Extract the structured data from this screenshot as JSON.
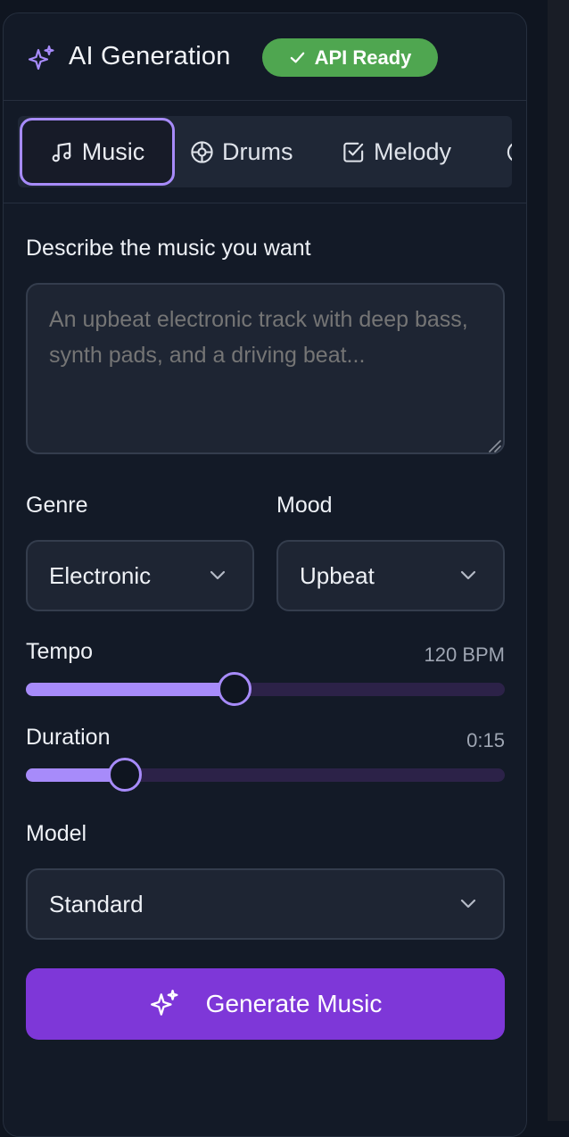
{
  "header": {
    "title": "AI Generation",
    "badge": "API Ready",
    "badge_color": "#4fa650",
    "icon": "sparkle-icon"
  },
  "tabs": [
    {
      "label": "Music",
      "icon": "music-note-icon",
      "active": true
    },
    {
      "label": "Drums",
      "icon": "drum-icon",
      "active": false
    },
    {
      "label": "Melody",
      "icon": "checkbox-icon",
      "active": false
    }
  ],
  "prompt": {
    "label": "Describe the music you want",
    "placeholder": "An upbeat electronic track with deep bass, synth pads, and a driving beat..."
  },
  "genre": {
    "label": "Genre",
    "value": "Electronic"
  },
  "mood": {
    "label": "Mood",
    "value": "Upbeat"
  },
  "tempo": {
    "label": "Tempo",
    "value_text": "120 BPM",
    "fraction": 0.435
  },
  "duration": {
    "label": "Duration",
    "value_text": "0:15",
    "fraction": 0.207
  },
  "model": {
    "label": "Model",
    "value": "Standard"
  },
  "generate": {
    "label": "Generate Music",
    "icon": "sparkle-icon"
  },
  "colors": {
    "accent": "#a78bfa",
    "button": "#7e37d8",
    "background": "#131a27"
  }
}
